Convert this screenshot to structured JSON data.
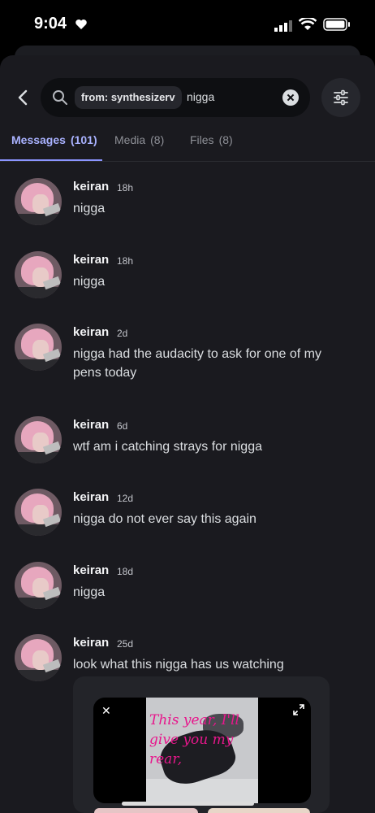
{
  "status_bar": {
    "time": "9:04"
  },
  "search": {
    "filter_chip": "from: synthesizerv",
    "query": "nigga"
  },
  "tabs": [
    {
      "label": "Messages",
      "count": "(101)"
    },
    {
      "label": "Media",
      "count": "(8)"
    },
    {
      "label": "Files",
      "count": "(8)"
    }
  ],
  "results": [
    {
      "author": "keiran",
      "time": "18h",
      "text": "nigga"
    },
    {
      "author": "keiran",
      "time": "18h",
      "text": "nigga"
    },
    {
      "author": "keiran",
      "time": "2d",
      "text": "nigga had the audacity to ask for one of my pens today"
    },
    {
      "author": "keiran",
      "time": "6d",
      "text": "wtf am i catching strays for nigga"
    },
    {
      "author": "keiran",
      "time": "12d",
      "text": "nigga do not ever say this again"
    },
    {
      "author": "keiran",
      "time": "18d",
      "text": "nigga"
    },
    {
      "author": "keiran",
      "time": "25d",
      "text": "look what this nigga has us watching"
    }
  ],
  "embed": {
    "caption": "This year, I'll give you my rear,"
  }
}
